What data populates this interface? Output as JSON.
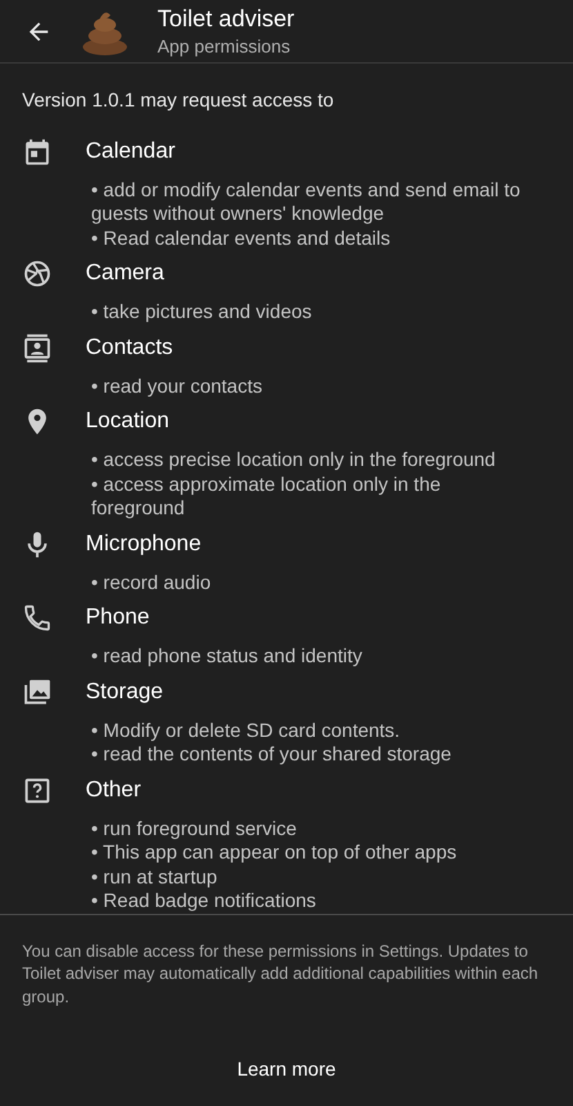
{
  "header": {
    "title": "Toilet adviser",
    "subtitle": "App permissions"
  },
  "intro": "Version 1.0.1 may request access to",
  "groups": [
    {
      "kind": "calendar",
      "title": "Calendar",
      "items": [
        "• add or modify calendar events and send email to guests without owners' knowledge",
        "• Read calendar events and details"
      ]
    },
    {
      "kind": "camera",
      "title": "Camera",
      "items": [
        "• take pictures and videos"
      ]
    },
    {
      "kind": "contacts",
      "title": "Contacts",
      "items": [
        "• read your contacts"
      ]
    },
    {
      "kind": "location",
      "title": "Location",
      "items": [
        "• access precise location only in the foreground",
        "• access approximate location only in the foreground"
      ]
    },
    {
      "kind": "microphone",
      "title": "Microphone",
      "items": [
        "• record audio"
      ]
    },
    {
      "kind": "phone",
      "title": "Phone",
      "items": [
        "• read phone status and identity"
      ]
    },
    {
      "kind": "storage",
      "title": "Storage",
      "items": [
        "• Modify or delete SD card contents.",
        "• read the contents of your shared storage"
      ]
    },
    {
      "kind": "other",
      "title": "Other",
      "items": [
        "• run foreground service",
        "• This app can appear on top of other apps",
        "• run at startup",
        "• Read badge notifications"
      ]
    }
  ],
  "footer": "You can disable access for these permissions in Settings. Updates to Toilet adviser may automatically add additional capabilities within each group.",
  "learn_more": "Learn more"
}
